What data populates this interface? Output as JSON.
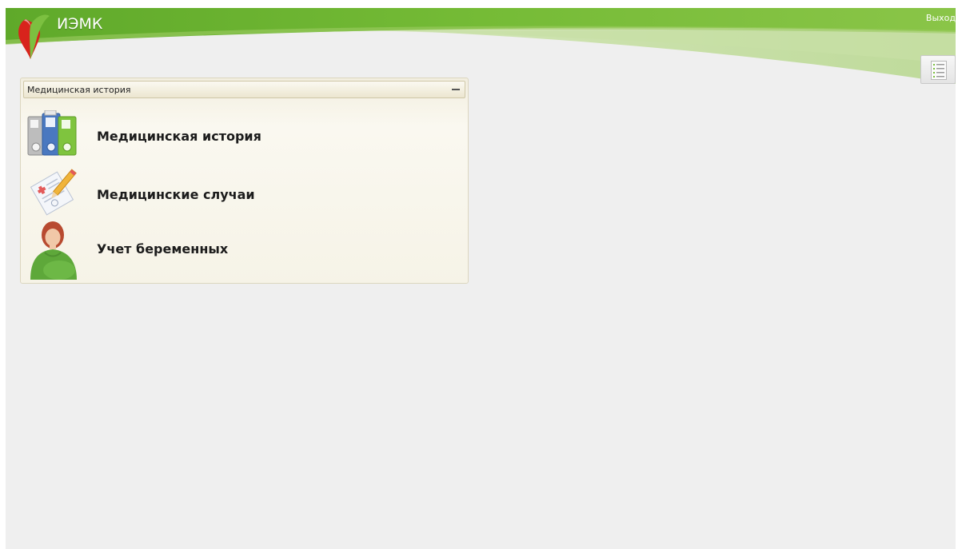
{
  "header": {
    "app_title": "ИЭМК",
    "logout_label": "Выход",
    "menu_icon": "list-icon"
  },
  "panel": {
    "title": "Медицинская история",
    "collapse_icon": "minus-icon",
    "items": [
      {
        "label": "Медицинская история",
        "icon": "folders-icon"
      },
      {
        "label": "Медицинские случаи",
        "icon": "medical-record-icon"
      },
      {
        "label": "Учет беременных",
        "icon": "pregnant-woman-icon"
      }
    ]
  },
  "colors": {
    "brand_green": "#6eb42e",
    "brand_red": "#d8231c",
    "panel_bg": "#f7f4e9",
    "page_bg": "#efefef"
  }
}
